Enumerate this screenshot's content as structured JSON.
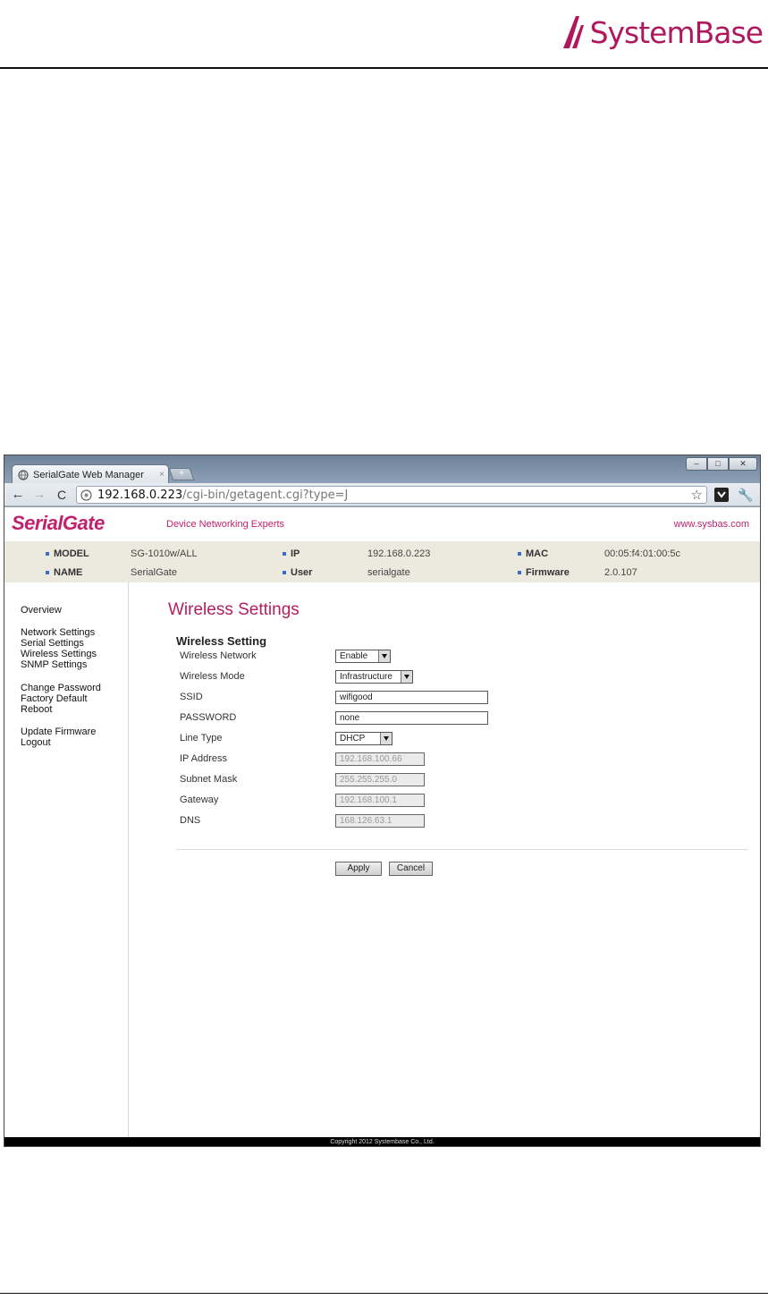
{
  "document": {
    "logo_text": "SystemBase"
  },
  "browser": {
    "tab_title": "SerialGate Web Manager",
    "tab_close": "×",
    "new_tab": "+",
    "url_host": "192.168.0.223",
    "url_path": "/cgi-bin/getagent.cgi?type=J",
    "window_controls": {
      "min": "–",
      "max": "□",
      "close": "✕"
    },
    "nav": {
      "back": "←",
      "forward": "→",
      "reload": "C"
    }
  },
  "site": {
    "brand": "SerialGate",
    "tagline": "Device Networking Experts",
    "link": "www.sysbas.com"
  },
  "device_info": {
    "model_label": "MODEL",
    "model_value": "SG-1010w/ALL",
    "ip_label": "IP",
    "ip_value": "192.168.0.223",
    "mac_label": "MAC",
    "mac_value": "00:05:f4:01:00:5c",
    "name_label": "NAME",
    "name_value": "SerialGate",
    "user_label": "User",
    "user_value": "serialgate",
    "firmware_label": "Firmware",
    "firmware_value": "2.0.107"
  },
  "sidebar": {
    "items": [
      "Overview",
      "Network Settings",
      "Serial Settings",
      "Wireless Settings",
      "SNMP Settings",
      "Change Password",
      "Factory Default",
      "Reboot",
      "Update Firmware",
      "Logout"
    ]
  },
  "main": {
    "heading": "Wireless Settings",
    "section_title": "Wireless Setting",
    "fields": {
      "wireless_network": {
        "label": "Wireless Network",
        "value": "Enable"
      },
      "wireless_mode": {
        "label": "Wireless Mode",
        "value": "Infrastructure"
      },
      "ssid": {
        "label": "SSID",
        "value": "wifigood"
      },
      "password": {
        "label": "PASSWORD",
        "value": "none"
      },
      "line_type": {
        "label": "Line Type",
        "value": "DHCP"
      },
      "ip_address": {
        "label": "IP Address",
        "value": "192.168.100.66"
      },
      "subnet_mask": {
        "label": "Subnet Mask",
        "value": "255.255.255.0"
      },
      "gateway": {
        "label": "Gateway",
        "value": "192.168.100.1"
      },
      "dns": {
        "label": "DNS",
        "value": "168.126.63.1"
      }
    },
    "apply_label": "Apply",
    "cancel_label": "Cancel"
  },
  "footer": {
    "copyright": "Copyright 2012 Systembase Co., Ltd."
  },
  "colors": {
    "brand": "#c0226d",
    "info_bar": "#ece9df",
    "footer": "#000000"
  }
}
